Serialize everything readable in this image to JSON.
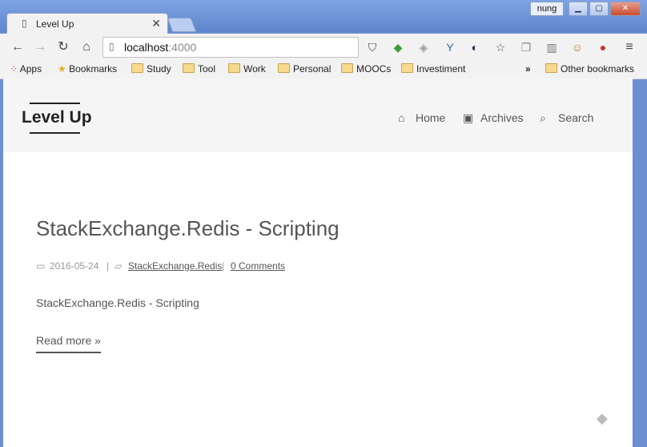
{
  "tab": {
    "title": "Level Up",
    "close": "✕"
  },
  "user": "nung",
  "window": {
    "minimize": "▁",
    "maximize": "▢",
    "close": "✕"
  },
  "omnibox": {
    "host": "localhost",
    "port": ":4000"
  },
  "bookmarks": {
    "apps": "Apps",
    "items": [
      "Bookmarks",
      "Study",
      "Tool",
      "Work",
      "Personal",
      "MOOCs",
      "Investiment"
    ],
    "overflow": "»",
    "other": "Other bookmarks"
  },
  "site": {
    "logo": "Level Up",
    "nav": [
      {
        "label": "Home"
      },
      {
        "label": "Archives"
      },
      {
        "label": "Search"
      }
    ]
  },
  "post": {
    "title": "StackExchange.Redis - Scripting",
    "date": "2016-05-24",
    "category": "StackExchange.Redis",
    "comments": "0 Comments",
    "separator": "|",
    "excerpt": "StackExchange.Redis - Scripting",
    "read_more": "Read more »"
  }
}
